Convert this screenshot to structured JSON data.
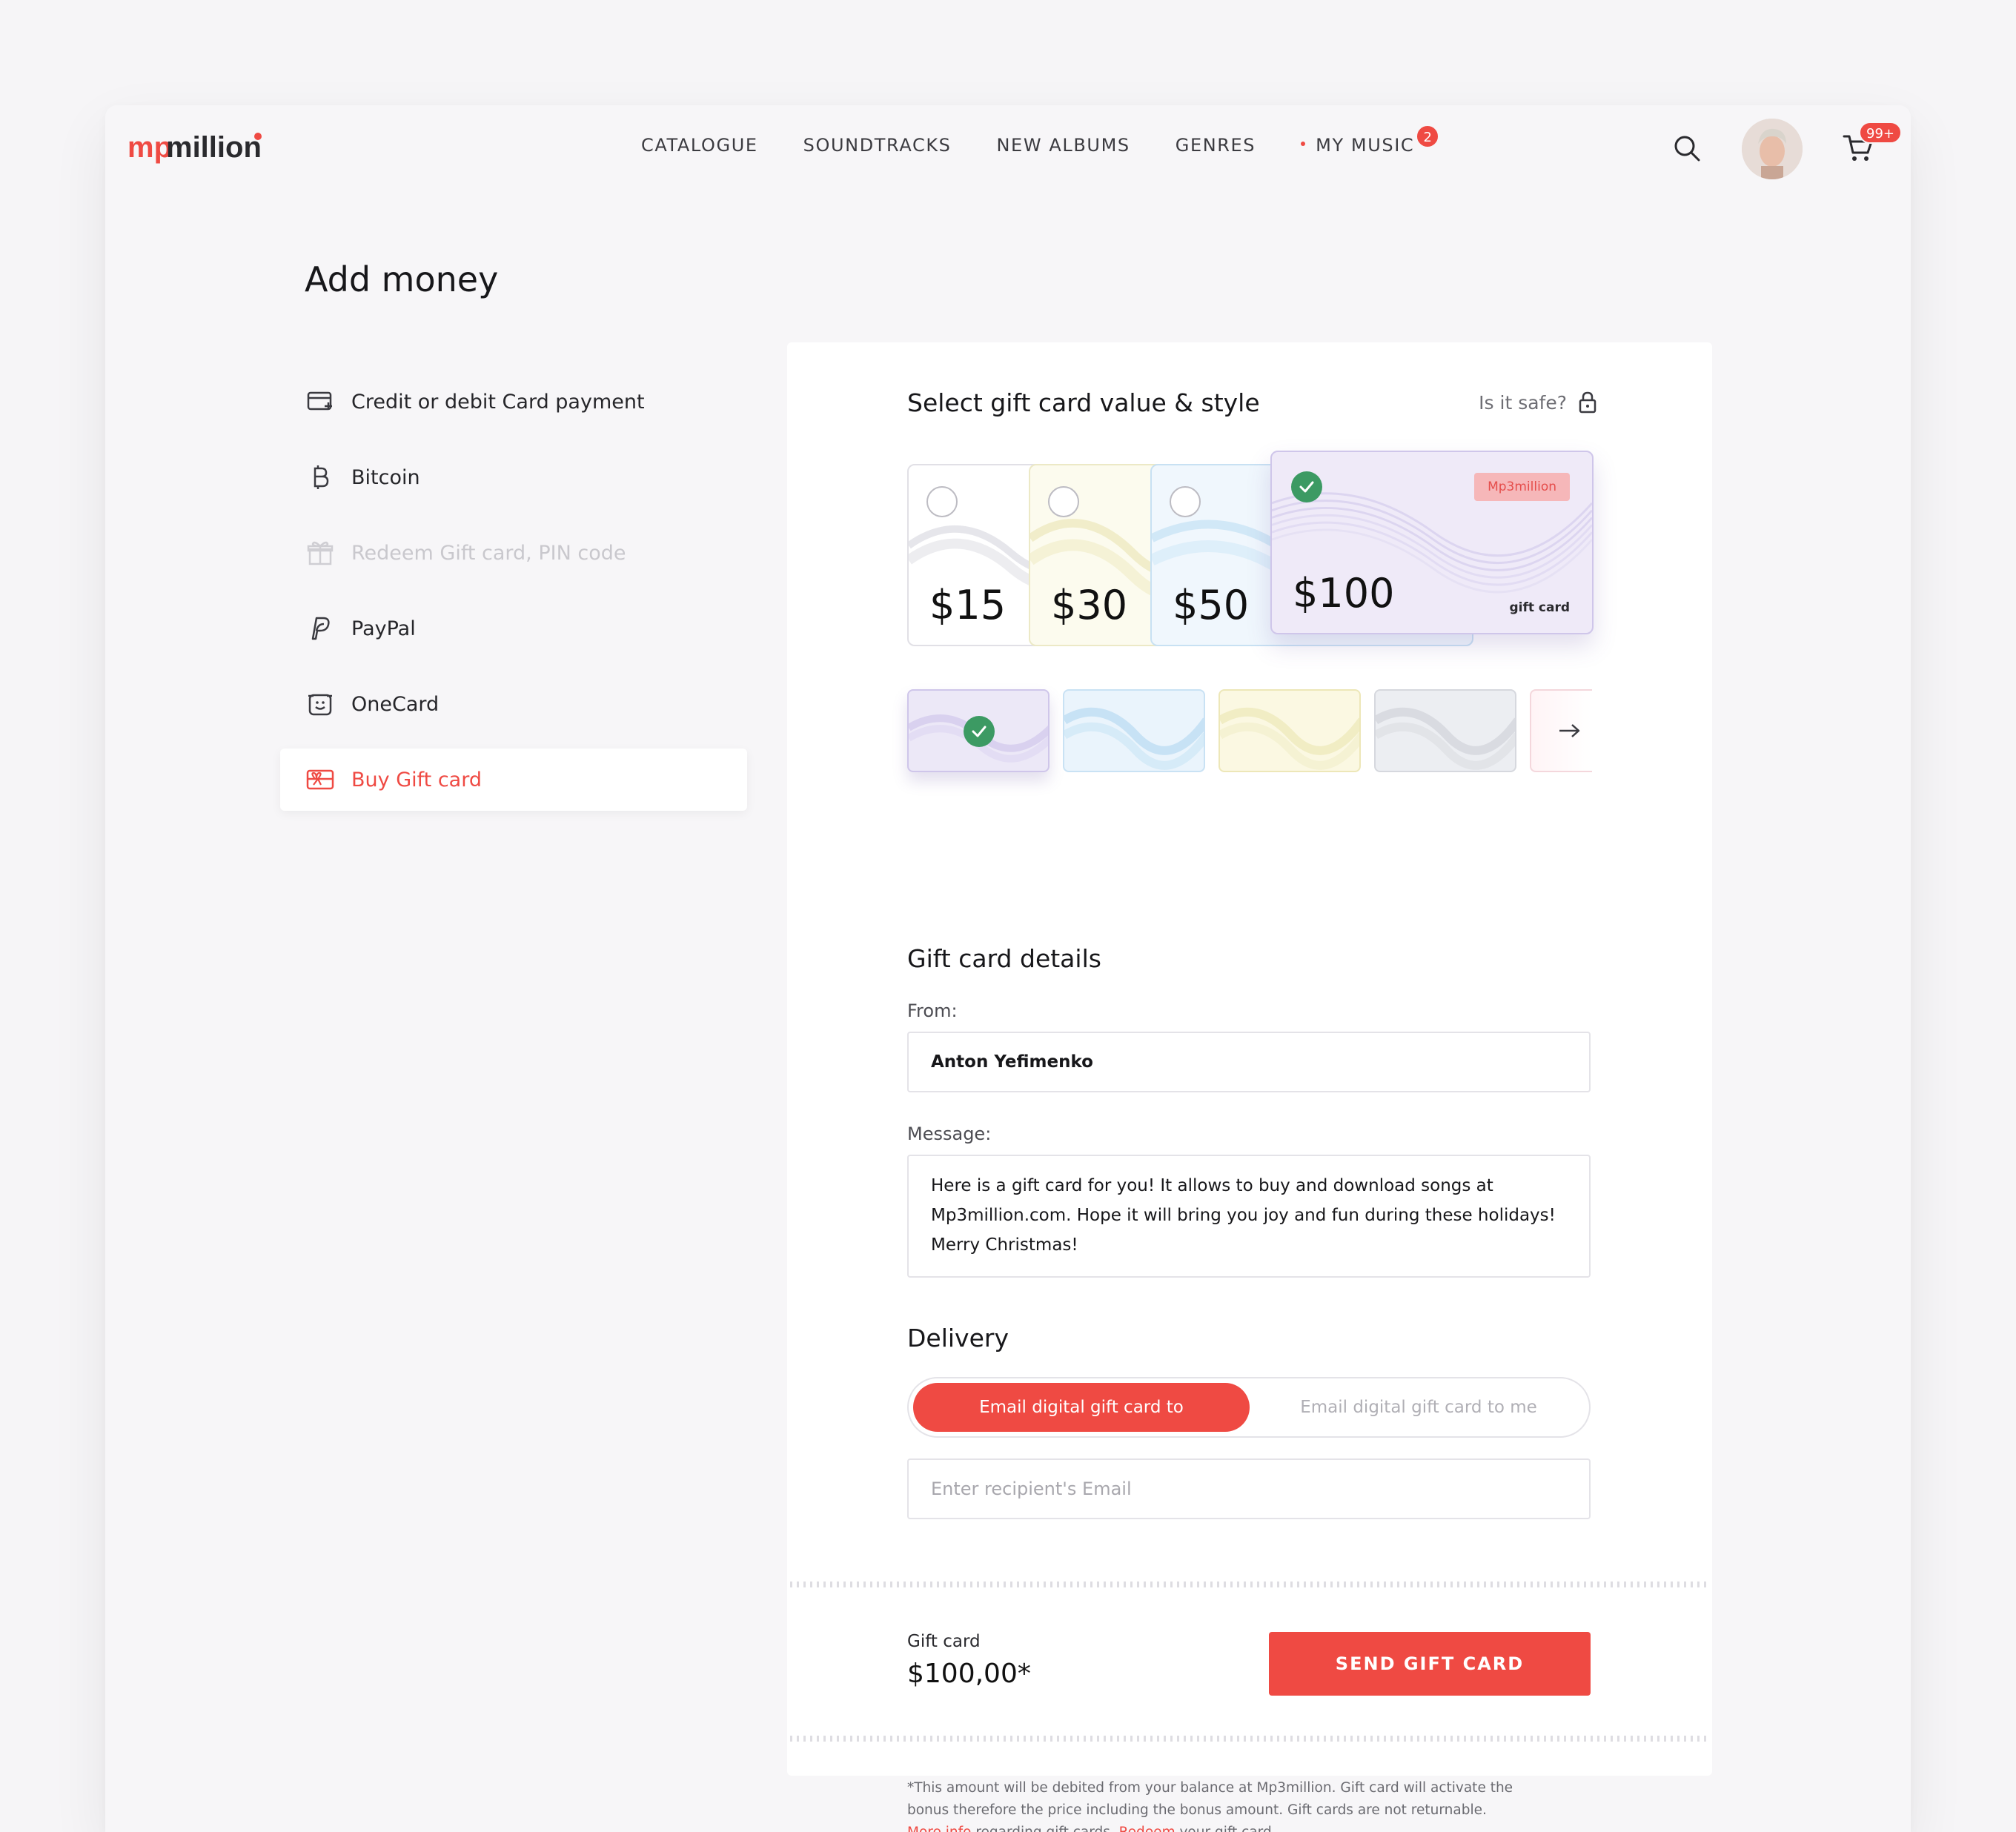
{
  "brand": {
    "logo_text": "mp3million",
    "accent": "#ef4a43"
  },
  "nav": {
    "items": [
      "CATALOGUE",
      "SOUNDTRACKS",
      "NEW ALBUMS",
      "GENRES"
    ],
    "my_music": "MY MUSIC",
    "my_music_badge": "2",
    "cart_badge": "99+"
  },
  "page": {
    "title": "Add money"
  },
  "sidebar": {
    "items": [
      {
        "label": "Credit or debit Card payment",
        "icon": "card-icon",
        "state": "default"
      },
      {
        "label": "Bitcoin",
        "icon": "bitcoin-icon",
        "state": "default"
      },
      {
        "label": "Redeem Gift card, PIN code",
        "icon": "gift-icon",
        "state": "disabled"
      },
      {
        "label": "PayPal",
        "icon": "paypal-icon",
        "state": "default"
      },
      {
        "label": "OneCard",
        "icon": "onecard-icon",
        "state": "default"
      },
      {
        "label": "Buy Gift card",
        "icon": "gift-card-icon",
        "state": "active"
      }
    ]
  },
  "gift": {
    "section_title": "Select gift card value & style",
    "safe_label": "Is it safe?",
    "values": [
      {
        "amount": "$15",
        "selected": false
      },
      {
        "amount": "$30",
        "selected": false
      },
      {
        "amount": "$50",
        "selected": false
      },
      {
        "amount": "$100",
        "selected": true
      }
    ],
    "card_brand": "Mp3million",
    "card_caption": "gift card",
    "styles": [
      {
        "name": "lavender",
        "color": "#ece8f7",
        "selected": true
      },
      {
        "name": "blue",
        "color": "#e4f1fb",
        "selected": false
      },
      {
        "name": "yellow",
        "color": "#fbf8e0",
        "selected": false
      },
      {
        "name": "grey",
        "color": "#eceef2",
        "selected": false
      },
      {
        "name": "pink",
        "color": "#fdeef0",
        "selected": false
      }
    ]
  },
  "details": {
    "title": "Gift card details",
    "from_label": "From:",
    "from_value": "Anton Yefimenko",
    "message_label": "Message:",
    "message_lines": [
      "Here is a gift card for you! It allows to buy and download songs at",
      "Mp3million.com. Hope it will bring you joy and fun during these holidays!",
      "Merry Christmas!"
    ]
  },
  "delivery": {
    "title": "Delivery",
    "option_to": "Email digital gift card to",
    "option_me": "Email digital gift card to me",
    "email_placeholder": "Enter recipient's Email"
  },
  "summary": {
    "label": "Gift card",
    "value": "$100,00*",
    "button": "SEND GIFT CARD"
  },
  "footnote": {
    "line1": "*This amount will be debited from your balance at Mp3million. Gift card will activate the",
    "line2": "bonus therefore the price including the bonus amount. Gift cards are not returnable.",
    "more_info": "More info",
    "mid": " regarding gift cards. ",
    "redeem": "Redeem",
    "end": " your gift card."
  }
}
